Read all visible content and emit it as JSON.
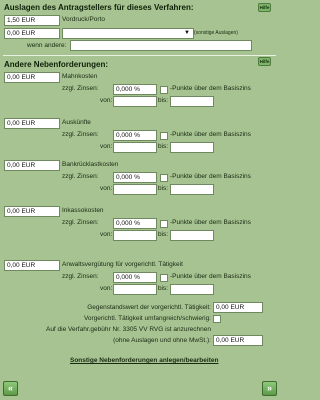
{
  "auslagen": {
    "title": "Auslagen des Antragstellers für dieses Verfahren:",
    "porto_value": "1,50 EUR",
    "porto_label": "Vordruck/Porto",
    "sonstige_value": "0,00 EUR",
    "sonstige_label": "(sonstige Auslagen)",
    "wenn_andere_label": "wenn andere:",
    "help_label": "Hilfe"
  },
  "nebenforderungen": {
    "title": "Andere Nebenforderungen:",
    "help_label": "Hilfe",
    "zinsen_label": "zzgl. Zinsen:",
    "punkte_label": "-Punkte über dem Basiszins",
    "von_label": "von:",
    "bis_label": "bis:",
    "items": [
      {
        "amount": "0,00 EUR",
        "name": "Mahnkosten",
        "rate": "0,000 %"
      },
      {
        "amount": "0,00 EUR",
        "name": "Auskünfte",
        "rate": "0,000 %"
      },
      {
        "amount": "0,00 EUR",
        "name": "Bankrücklastkosten",
        "rate": "0,000 %"
      },
      {
        "amount": "0,00 EUR",
        "name": "Inkassokosten",
        "rate": "0,000 %"
      },
      {
        "amount": "0,00 EUR",
        "name": "Anwaltsvergütung für vorgerichtl. Tätigkeit",
        "rate": "0,000 %"
      }
    ]
  },
  "gegenstandswert": {
    "label": "Gegenstandswert der vorgerichtl. Tätigkeit:",
    "value": "0,00 EUR",
    "umfangreich_label": "Vorgerichtl. Tätigkeit umfangreich/schwierig:",
    "anrechnen_label_1": "Auf die Verfahr.gebühr Nr. 3305 VV RVG ist anzurechnen",
    "anrechnen_label_2": "(ohne Auslagen und ohne MwSt.):",
    "anrechnen_value": "0,00 EUR"
  },
  "link_label": "Sonstige Nebenforderungen anlegen/bearbeiten",
  "nav": {
    "back_glyph": "«",
    "next_glyph": "»"
  }
}
